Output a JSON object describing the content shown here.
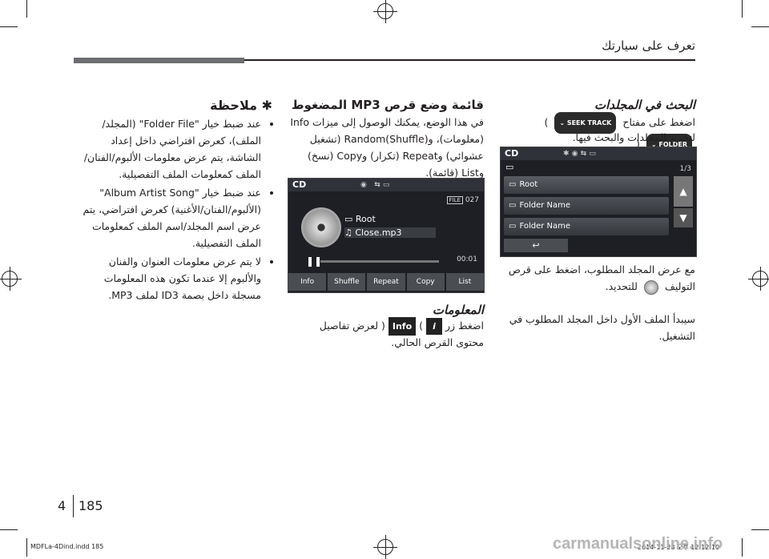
{
  "header": {
    "title": "تعرف على سيارتك"
  },
  "col_right": {
    "heading": "البحث في المجلدات",
    "line1a": "اضغط على مفتاح",
    "seek_label": "SEEK TRACK",
    "folder_label": "FOLDER",
    "line2": "لتحديد المجلدات والبحث فيها.",
    "screen": {
      "source": "CD",
      "page": "1/3",
      "items": [
        "Root",
        "Folder Name",
        "Folder Name"
      ]
    },
    "para2a": "مع عرض المجلد المطلوب، اضغط على قرص",
    "para2b": "التوليف",
    "para2c": "للتحديد.",
    "para3": "سيبدأ الملف الأول داخل المجلد المطلوب في التشغيل."
  },
  "col_mid": {
    "heading": "قائمة وضع قرص MP3 المضغوط",
    "para": "في هذا الوضع، يمكنك الوصول إلى ميزات Info (معلومات)، وRandom(Shuffle) (تشغيل عشوائي) وRepeat (تكرار) وCopy (نسخ) وList (قائمة).",
    "screen": {
      "source": "CD",
      "file_badge": "FILE",
      "file_num": "027",
      "folder": "Root",
      "track": "Close.mp3",
      "time": "00:01",
      "menu": [
        "Info",
        "Shuffle",
        "Repeat",
        "Copy",
        "List"
      ]
    },
    "info_heading": "المعلومات",
    "info_a": "اضغط زر",
    "info_key": "Info",
    "info_b": "لعرض تفاصيل",
    "info_c": "محتوى القرص الحالي."
  },
  "col_left": {
    "heading": "✱ ملاحظة",
    "bullets": [
      "عند ضبط خيار \"Folder File\" (المجلد/الملف)، كعرض افتراضي داخل إعداد الشاشة، يتم عرض معلومات الألبوم/الفنان/الملف كمعلومات الملف التفصيلية.",
      "عند ضبط خيار \"Album Artist Song\" (الألبوم/الفنان/الأغنية) كعرض افتراضي، يتم عرض اسم المجلد/اسم الملف كمعلومات الملف التفصيلية.",
      "لا يتم عرض معلومات العنوان والفنان والألبوم إلا عندما تكون هذه المعلومات مسجلة داخل بصمة ID3 لملف MP3."
    ]
  },
  "footer": {
    "section": "4",
    "page": "185",
    "file_info": "MDFLa-4Dind.indd   185",
    "date_info": "2014-11-28   오후 12:12:10",
    "watermark": "carmanualsonline.info"
  }
}
